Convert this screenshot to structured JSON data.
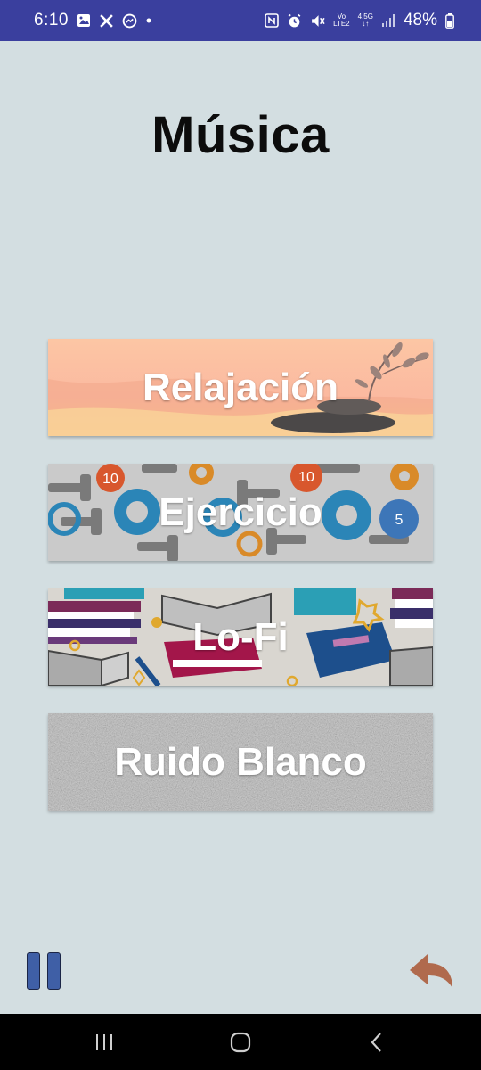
{
  "status_bar": {
    "time": "6:10",
    "battery": "48%",
    "left_icons": [
      "gallery-icon",
      "x-icon",
      "messenger-icon",
      "dot-icon"
    ],
    "right_icons": [
      "nfc-icon",
      "alarm-icon",
      "mute-icon",
      "volte-icon",
      "4g-icon",
      "signal-icon",
      "battery-icon"
    ],
    "volte_label_top": "Vo",
    "volte_label_bottom": "LTE2",
    "network_label": "4.5G"
  },
  "page": {
    "title": "Música"
  },
  "cards": {
    "relax": {
      "label": "Relajación"
    },
    "exercise": {
      "label": "Ejercicio"
    },
    "lofi": {
      "label": "Lo-Fi"
    },
    "white_noise": {
      "label": "Ruido Blanco"
    }
  },
  "controls": {
    "pause_icon": "pause-icon",
    "back_icon": "back-arrow-icon",
    "back_color": "#b06a4d",
    "pause_color": "#3f5fa6"
  },
  "nav_bar": {
    "items": [
      "recent-apps-icon",
      "home-icon",
      "back-icon"
    ]
  },
  "colors": {
    "background": "#d3dee1",
    "status_bar": "#3a3f9e"
  }
}
